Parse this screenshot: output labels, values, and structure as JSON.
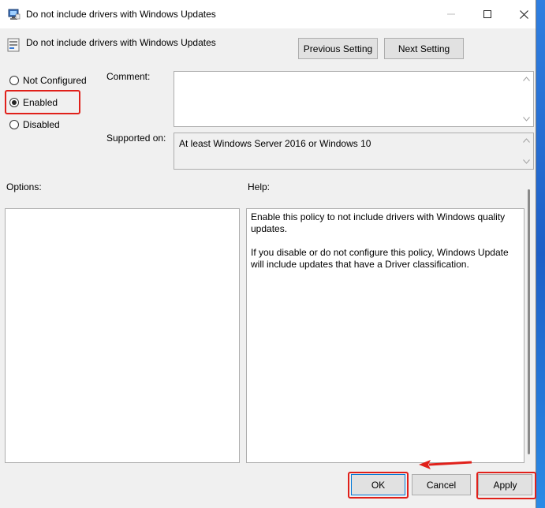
{
  "window": {
    "title": "Do not include drivers with Windows Updates",
    "app_icon": "policy-app-icon"
  },
  "header": {
    "policy_name": "Do not include drivers with Windows Updates",
    "previous_label": "Previous Setting",
    "next_label": "Next Setting"
  },
  "state": {
    "options": [
      {
        "label": "Not Configured",
        "checked": false
      },
      {
        "label": "Enabled",
        "checked": true
      },
      {
        "label": "Disabled",
        "checked": false
      }
    ]
  },
  "comment": {
    "label": "Comment:",
    "value": ""
  },
  "supported": {
    "label": "Supported on:",
    "value": "At least Windows Server 2016 or Windows 10"
  },
  "options_panel": {
    "label": "Options:"
  },
  "help_panel": {
    "label": "Help:",
    "paragraphs": [
      "Enable this policy to not include drivers with Windows quality updates.",
      "If you disable or do not configure this policy, Windows Update will include updates that have a Driver classification."
    ]
  },
  "footer": {
    "ok_label": "OK",
    "cancel_label": "Cancel",
    "apply_label": "Apply"
  },
  "colors": {
    "highlight": "#e0201a",
    "accent": "#0078d7"
  }
}
